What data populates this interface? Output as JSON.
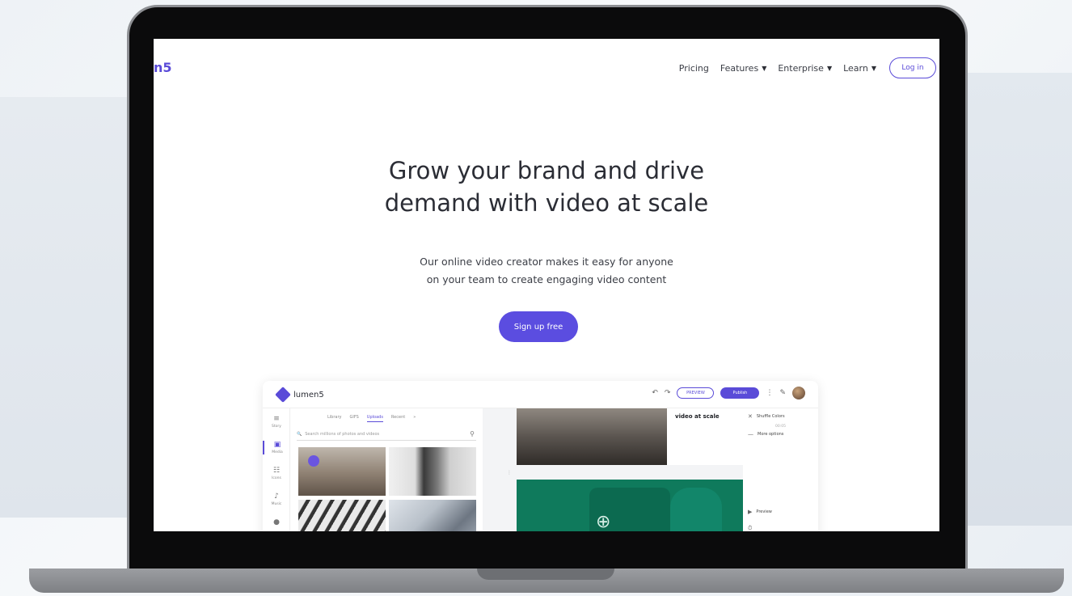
{
  "nav": {
    "logo": "n5",
    "links": [
      {
        "label": "Pricing",
        "has_dropdown": false
      },
      {
        "label": "Features",
        "has_dropdown": true
      },
      {
        "label": "Enterprise",
        "has_dropdown": true
      },
      {
        "label": "Learn",
        "has_dropdown": true
      }
    ],
    "login": "Log in"
  },
  "hero": {
    "headline_line1": "Grow your brand and drive",
    "headline_line2": "demand with video at scale",
    "sub_line1": "Our online video creator makes it easy for anyone",
    "sub_line2": "on your team to create engaging video content",
    "cta": "Sign up free"
  },
  "app": {
    "logo": "lumen5",
    "preview": "PREVIEW",
    "publish": "Publish",
    "rail": [
      "Story",
      "Media",
      "Icons",
      "Music"
    ],
    "media_tabs": [
      "Library",
      "GIFS",
      "Uploads",
      "Recent"
    ],
    "search_placeholder": "Search millions of photos and videos",
    "scene_text": "video at scale",
    "options": {
      "shuffle": "Shuffle Colors",
      "time": "00:05",
      "more": "More options",
      "preview": "Preview"
    }
  },
  "colors": {
    "accent": "#5a4bd8",
    "cta": "#5b4de0",
    "scene_green": "#0f7a5c"
  }
}
